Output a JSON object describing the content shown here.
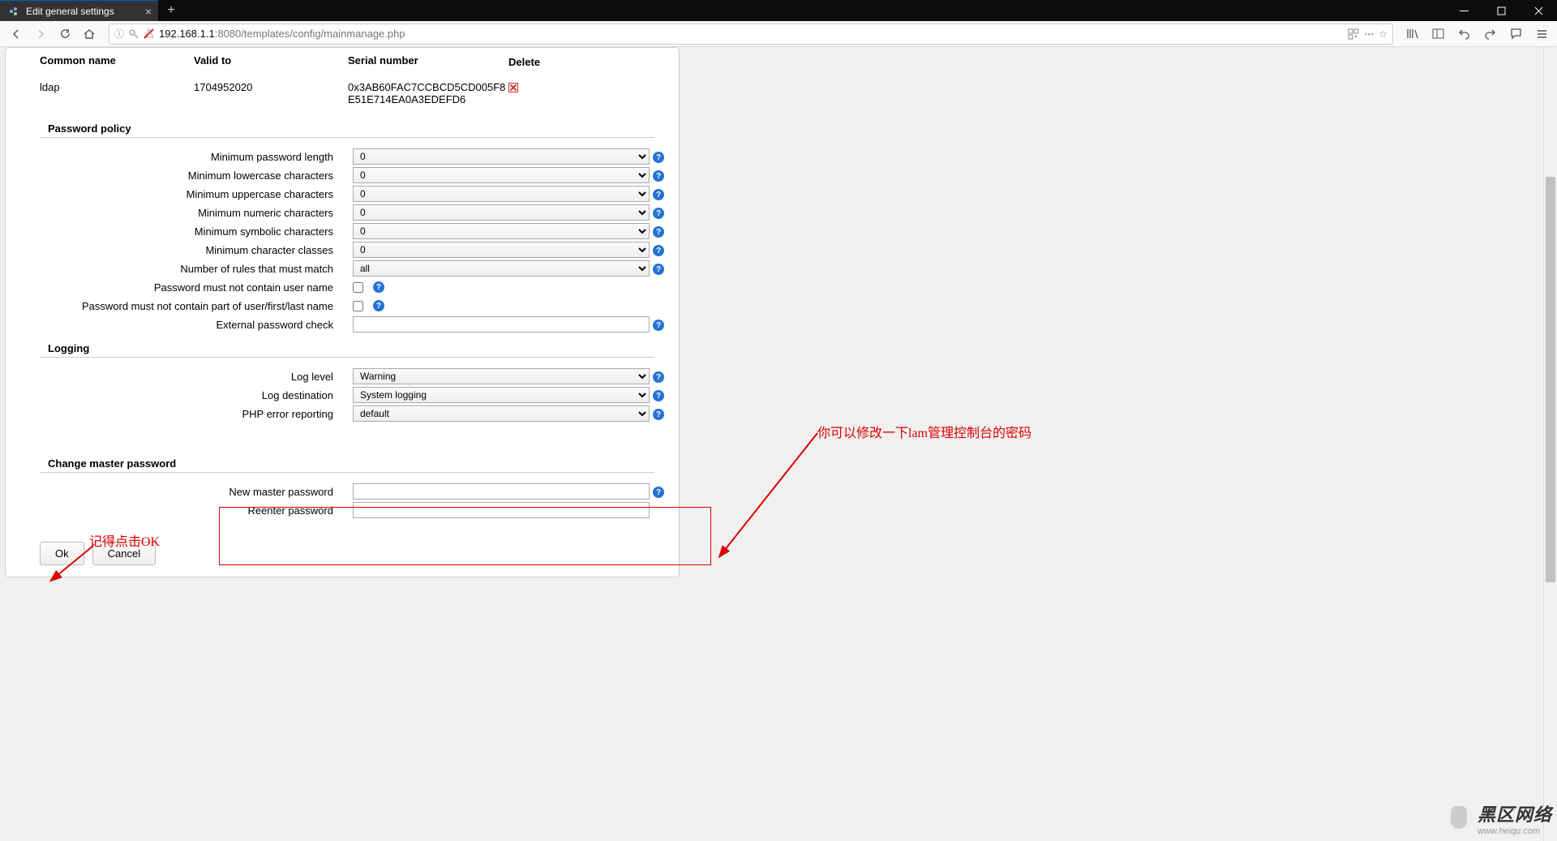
{
  "browser": {
    "tab_title": "Edit general settings",
    "url_prefix": "192.168.1.1",
    "url_suffix": ":8080/templates/config/mainmanage.php"
  },
  "cert": {
    "headers": {
      "name": "Common name",
      "valid": "Valid to",
      "serial": "Serial number",
      "delete": "Delete"
    },
    "row": {
      "name": "ldap",
      "valid": "1704952020",
      "serial": "0x3AB60FAC7CCBCD5CD005F8E51E714EA0A3EDEFD6"
    }
  },
  "sections": {
    "password_policy": "Password policy",
    "logging": "Logging",
    "change_master": "Change master password"
  },
  "labels": {
    "min_len": "Minimum password length",
    "min_lower": "Minimum lowercase characters",
    "min_upper": "Minimum uppercase characters",
    "min_num": "Minimum numeric characters",
    "min_sym": "Minimum symbolic characters",
    "min_class": "Minimum character classes",
    "rules_match": "Number of rules that must match",
    "no_username": "Password must not contain user name",
    "no_userpart": "Password must not contain part of user/first/last name",
    "ext_check": "External password check",
    "log_level": "Log level",
    "log_dest": "Log destination",
    "php_err": "PHP error reporting",
    "new_master": "New master password",
    "reenter": "Reenter password"
  },
  "values": {
    "min_len": "0",
    "min_lower": "0",
    "min_upper": "0",
    "min_num": "0",
    "min_sym": "0",
    "min_class": "0",
    "rules_match": "all",
    "log_level": "Warning",
    "log_dest": "System logging",
    "php_err": "default"
  },
  "buttons": {
    "ok": "Ok",
    "cancel": "Cancel"
  },
  "annotations": {
    "right": "你可以修改一下lam管理控制台的密码",
    "left": "记得点击OK"
  },
  "watermark": {
    "big": "黑区网络",
    "small": "www.heiqu.com"
  }
}
